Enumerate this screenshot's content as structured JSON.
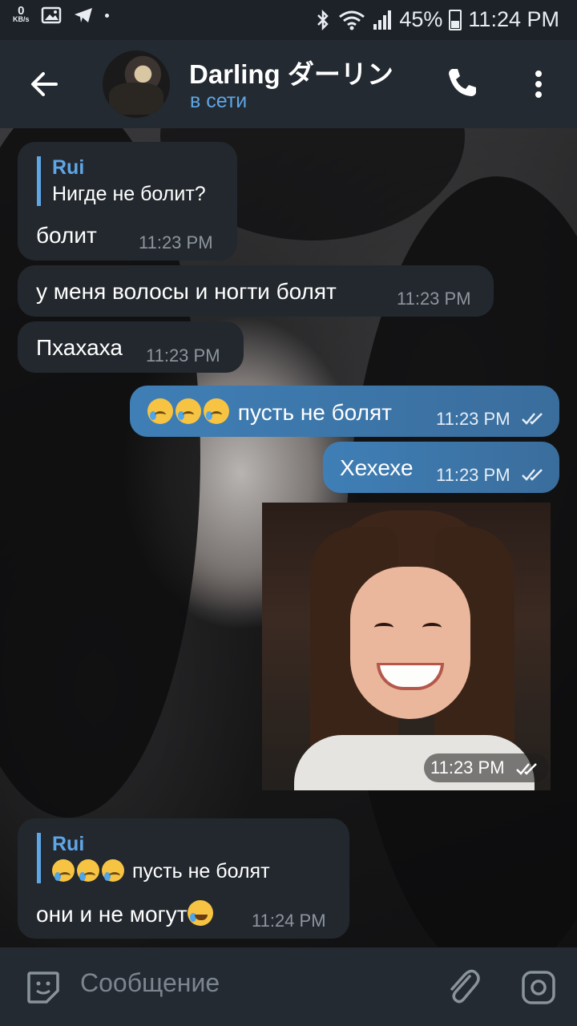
{
  "status_bar": {
    "net_speed_value": "0",
    "net_speed_unit": "KB/s",
    "battery": "45%",
    "time": "11:24 PM",
    "icons": [
      "gallery-icon",
      "telegram-icon",
      "bluetooth-icon",
      "wifi-icon",
      "signal-icon",
      "battery-icon"
    ]
  },
  "header": {
    "title": "Darling ダーリン",
    "status": "в сети",
    "icons": [
      "back-arrow-icon",
      "phone-icon",
      "more-vertical-icon"
    ]
  },
  "messages": [
    {
      "dir": "in",
      "reply_name": "Rui",
      "reply_text": "Нигде не болит?",
      "text": "болит",
      "time": "11:23 PM"
    },
    {
      "dir": "in",
      "text": "у меня волосы и ногти болят",
      "time": "11:23 PM"
    },
    {
      "dir": "in",
      "text": "Пхахаха",
      "time": "11:23 PM"
    },
    {
      "dir": "out",
      "text": "пусть не болят",
      "emoji": [
        "crying-face",
        "crying-face",
        "crying-face"
      ],
      "time": "11:23 PM",
      "read": true
    },
    {
      "dir": "out",
      "text": "Хехехе",
      "time": "11:23 PM",
      "read": true
    },
    {
      "dir": "out",
      "type": "photo",
      "time": "11:23 PM",
      "read": true
    },
    {
      "dir": "in",
      "reply_name": "Rui",
      "reply_text": "пусть не болят",
      "reply_emoji": [
        "crying-face",
        "crying-face",
        "crying-face"
      ],
      "text": "они и не могут",
      "text_emoji": "laughing-tears-face",
      "time": "11:24 PM"
    }
  ],
  "composer": {
    "placeholder": "Сообщение",
    "icons": [
      "sticker-icon",
      "attach-icon",
      "camera-icon"
    ]
  },
  "colors": {
    "accent": "#5fa6e6",
    "outgoing_bubble": "#3f7fb6",
    "incoming_bubble": "#23282e",
    "header_bg": "#232a31"
  }
}
